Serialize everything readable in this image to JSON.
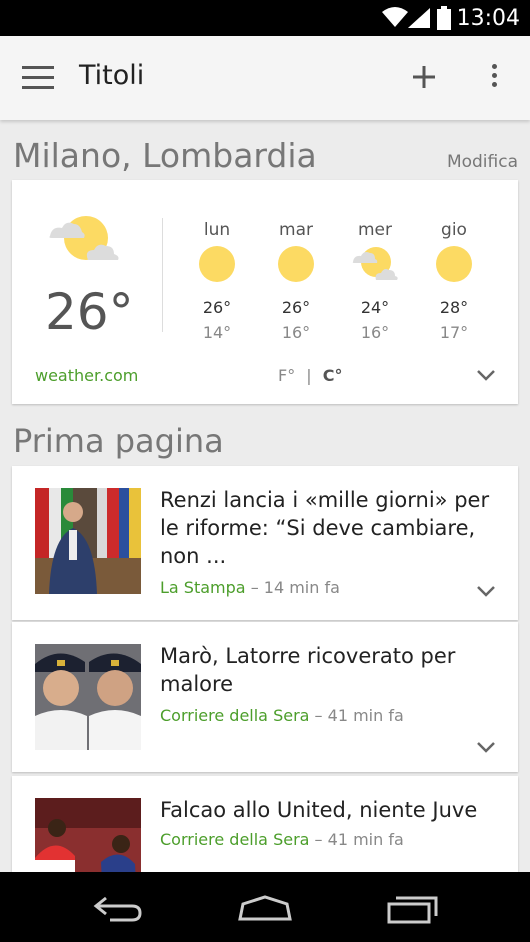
{
  "status_bar": {
    "time": "13:04"
  },
  "app_bar": {
    "title": "Titoli"
  },
  "weather": {
    "location": "Milano, Lombardia",
    "edit_label": "Modifica",
    "current_temp": "26°",
    "forecast": [
      {
        "day": "lun",
        "high": "26°",
        "low": "14°",
        "icon": "sun-icon"
      },
      {
        "day": "mar",
        "high": "26°",
        "low": "16°",
        "icon": "sun-icon"
      },
      {
        "day": "mer",
        "high": "24°",
        "low": "16°",
        "icon": "partly-cloudy-icon"
      },
      {
        "day": "gio",
        "high": "28°",
        "low": "17°",
        "icon": "sun-icon"
      }
    ],
    "source": "weather.com",
    "unit_f": "F°",
    "unit_sep": "|",
    "unit_c": "C°"
  },
  "section_title": "Prima pagina",
  "articles": [
    {
      "headline": "Renzi lancia i «mille giorni» per le riforme: “Si deve cambiare, non ...",
      "source": "La Stampa",
      "time": "– 14 min fa"
    },
    {
      "headline": "Marò, Latorre ricoverato per malore",
      "source": "Corriere della Sera",
      "time": "– 41 min fa"
    },
    {
      "headline": "Falcao allo United, niente Juve",
      "source": "Corriere della Sera",
      "time": "– 41 min fa"
    }
  ]
}
